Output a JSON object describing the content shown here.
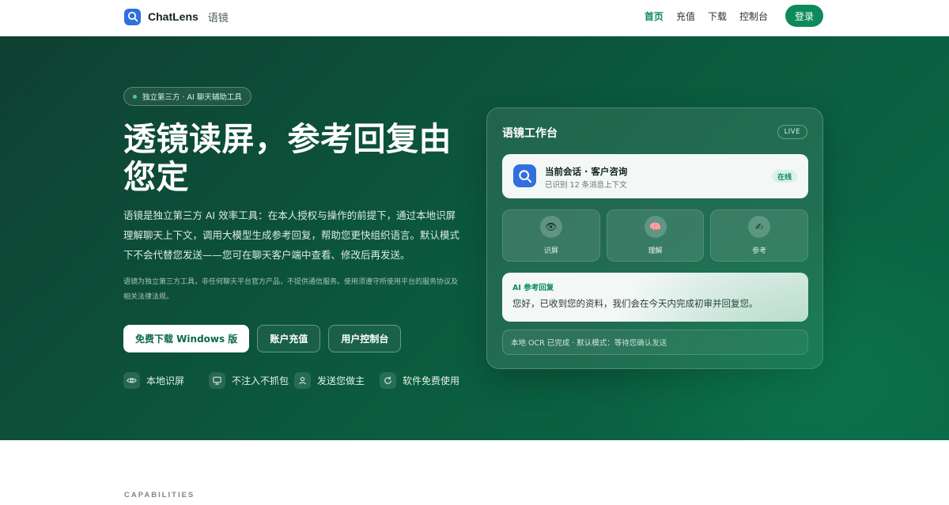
{
  "header": {
    "brand_name": "ChatLens",
    "brand_sub": "语镜",
    "nav": [
      {
        "label": "首页",
        "active": true
      },
      {
        "label": "充值",
        "active": false
      },
      {
        "label": "下载",
        "active": false
      },
      {
        "label": "控制台",
        "active": false
      }
    ],
    "login_label": "登录"
  },
  "hero": {
    "badge": "独立第三方 · AI 聊天辅助工具",
    "title": "透镜读屏，参考回复由您定",
    "description": "语镜是独立第三方 AI 效率工具：在本人授权与操作的前提下，通过本地识屏理解聊天上下文，调用大模型生成参考回复，帮助您更快组织语言。默认模式下不会代替您发送——您可在聊天客户端中查看、修改后再发送。",
    "note": "语镜为独立第三方工具，非任何聊天平台官方产品，不提供通信服务。使用须遵守所使用平台的服务协议及相关法律法规。",
    "buttons": {
      "download": "免费下载 Windows 版",
      "recharge": "账户充值",
      "console": "用户控制台"
    },
    "features": [
      {
        "icon": "eye-icon",
        "label": "本地识屏"
      },
      {
        "icon": "monitor-icon",
        "label": "不注入不抓包"
      },
      {
        "icon": "user-icon",
        "label": "发送您做主"
      },
      {
        "icon": "refresh-icon",
        "label": "软件免费使用"
      }
    ]
  },
  "workbench": {
    "title": "语镜工作台",
    "live": "LIVE",
    "session": {
      "title": "当前会话 · 客户咨询",
      "subtitle": "已识别 12 条消息上下文",
      "status": "在线"
    },
    "tiles": [
      {
        "icon": "eye-emoji-icon",
        "glyph": "👁",
        "label": "识屏"
      },
      {
        "icon": "brain-emoji-icon",
        "glyph": "🧠",
        "label": "理解"
      },
      {
        "icon": "writing-hand-emoji-icon",
        "glyph": "✍",
        "label": "参考"
      }
    ],
    "reply": {
      "tag": "AI 参考回复",
      "text": "您好，已收到您的资料，我们会在今天内完成初审并回复您。"
    },
    "status": "本地 OCR 已完成 · 默认模式：等待您确认发送"
  },
  "capabilities_label": "CAPABILITIES",
  "colors": {
    "accent": "#0e8a5a",
    "hero_dark": "#0f4032",
    "hero_light": "#0a6a48",
    "brand_blue": "#2f6fe0"
  }
}
